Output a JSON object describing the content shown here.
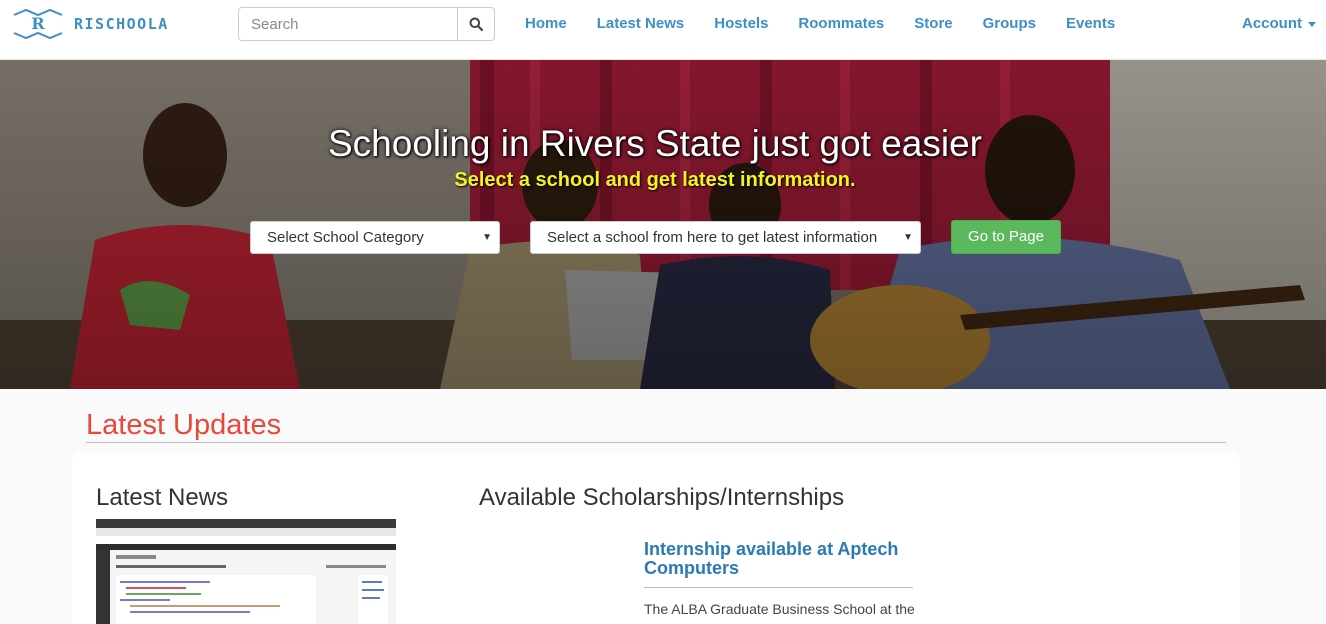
{
  "brand": {
    "name": "RISCHOOLA",
    "logo_icon": "r-logo-icon"
  },
  "search": {
    "placeholder": "Search",
    "icon": "search-icon"
  },
  "nav": {
    "links": [
      "Home",
      "Latest News",
      "Hostels",
      "Roommates",
      "Store",
      "Groups",
      "Events"
    ],
    "account": "Account"
  },
  "hero": {
    "title": "Schooling in Rivers State just got easier",
    "subtitle": "Select a school and get latest information.",
    "category_select": "Select School Category",
    "school_select": "Select a school from here to get latest information",
    "go_button": "Go to Page"
  },
  "updates": {
    "heading": "Latest Updates",
    "news_heading": "Latest News",
    "scholarships_heading": "Available Scholarships/Internships",
    "scholarship_item": {
      "title": "Internship available at Aptech Computers",
      "excerpt": "The ALBA Graduate Business School at the"
    }
  },
  "colors": {
    "brand_blue": "#3d8fc4",
    "accent_red": "#e9473a",
    "subtitle_yellow": "#f3f321",
    "button_green": "#5cb85c"
  }
}
